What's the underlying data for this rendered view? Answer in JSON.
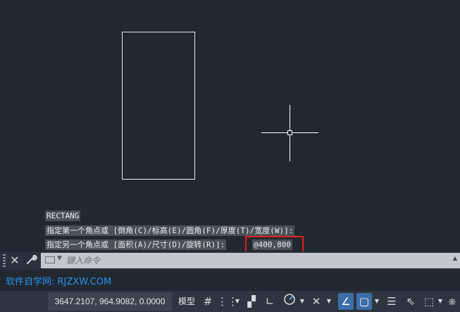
{
  "command_history": {
    "line1": "RECTANG",
    "line2": "指定第一个角点或 [倒角(C)/标高(E)/圆角(F)/厚度(T)/宽度(W)]:",
    "line3": "指定另一个角点或 [面积(A)/尺寸(D)/旋转(R)]:",
    "typed_value": "@400,800"
  },
  "command_line": {
    "placeholder": "键入命令",
    "close_icon": "✕",
    "wrench_icon": "🔧",
    "scroll_icon": "▲"
  },
  "watermark": "软件自学网: RJZXW.COM",
  "status_bar": {
    "coordinates": "3647.2107, 964.9082, 0.0000",
    "model_tab": "模型",
    "icons": [
      "grid-icon",
      "snap-icon",
      "ortho-icon",
      "polar-icon",
      "isodraft-icon",
      "osnap-track-icon",
      "osnap-icon",
      "annotation-icon",
      "workspace-icon",
      "transparency-icon",
      "selection-cycle-icon",
      "3d-osnap-icon",
      "customize-icon"
    ]
  },
  "colors": {
    "canvas": "#212830",
    "highlight": "#e02020",
    "watermark": "#2a8fe8",
    "status_active": "#3c6ea8"
  }
}
